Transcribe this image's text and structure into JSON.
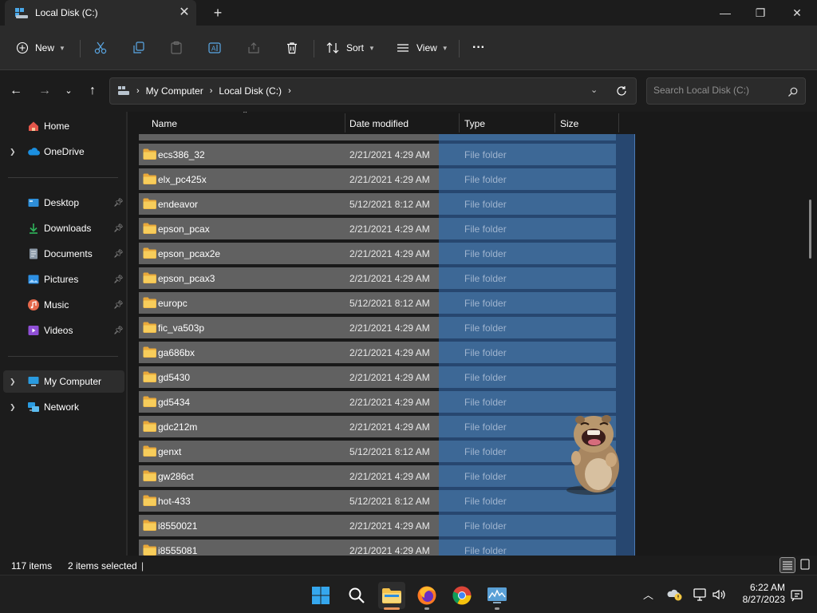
{
  "window": {
    "tab_title": "Local Disk (C:)",
    "close_tab": "✕",
    "new_tab": "+",
    "minimize": "—",
    "maximize": "❐",
    "close": "✕"
  },
  "toolbar": {
    "new_label": "New",
    "sort_label": "Sort",
    "view_label": "View",
    "more_label": "···"
  },
  "address": {
    "crumbs": [
      "My Computer",
      "Local Disk (C:)"
    ],
    "search_placeholder": "Search Local Disk (C:)"
  },
  "sidebar": {
    "items": [
      {
        "label": "Home",
        "icon": "home-icon"
      },
      {
        "label": "OneDrive",
        "icon": "cloud-icon"
      },
      {
        "label": "Desktop",
        "icon": "desktop-icon"
      },
      {
        "label": "Downloads",
        "icon": "download-icon"
      },
      {
        "label": "Documents",
        "icon": "document-icon"
      },
      {
        "label": "Pictures",
        "icon": "picture-icon"
      },
      {
        "label": "Music",
        "icon": "music-icon"
      },
      {
        "label": "Videos",
        "icon": "video-icon"
      },
      {
        "label": "My Computer",
        "icon": "computer-icon"
      },
      {
        "label": "Network",
        "icon": "network-icon"
      }
    ]
  },
  "columns": {
    "name": "Name",
    "date": "Date modified",
    "type": "Type",
    "size": "Size"
  },
  "files": [
    {
      "name": "ecs386_32",
      "date": "2/21/2021 4:29 AM",
      "type": "File folder"
    },
    {
      "name": "elx_pc425x",
      "date": "2/21/2021 4:29 AM",
      "type": "File folder"
    },
    {
      "name": "endeavor",
      "date": "5/12/2021 8:12 AM",
      "type": "File folder"
    },
    {
      "name": "epson_pcax",
      "date": "2/21/2021 4:29 AM",
      "type": "File folder"
    },
    {
      "name": "epson_pcax2e",
      "date": "2/21/2021 4:29 AM",
      "type": "File folder"
    },
    {
      "name": "epson_pcax3",
      "date": "2/21/2021 4:29 AM",
      "type": "File folder"
    },
    {
      "name": "europc",
      "date": "5/12/2021 8:12 AM",
      "type": "File folder"
    },
    {
      "name": "fic_va503p",
      "date": "2/21/2021 4:29 AM",
      "type": "File folder"
    },
    {
      "name": "ga686bx",
      "date": "2/21/2021 4:29 AM",
      "type": "File folder"
    },
    {
      "name": "gd5430",
      "date": "2/21/2021 4:29 AM",
      "type": "File folder"
    },
    {
      "name": "gd5434",
      "date": "2/21/2021 4:29 AM",
      "type": "File folder"
    },
    {
      "name": "gdc212m",
      "date": "2/21/2021 4:29 AM",
      "type": "File folder"
    },
    {
      "name": "genxt",
      "date": "5/12/2021 8:12 AM",
      "type": "File folder"
    },
    {
      "name": "gw286ct",
      "date": "2/21/2021 4:29 AM",
      "type": "File folder"
    },
    {
      "name": "hot-433",
      "date": "5/12/2021 8:12 AM",
      "type": "File folder"
    },
    {
      "name": "i8550021",
      "date": "2/21/2021 4:29 AM",
      "type": "File folder"
    },
    {
      "name": "i8555081",
      "date": "2/21/2021 4:29 AM",
      "type": "File folder"
    }
  ],
  "status": {
    "item_count": "117 items",
    "selected": "2 items selected"
  },
  "clock": {
    "time": "6:22 AM",
    "date": "8/27/2023"
  },
  "colors": {
    "accent": "#0078d4",
    "folder": "#f3c04a",
    "selection": "#274770"
  }
}
